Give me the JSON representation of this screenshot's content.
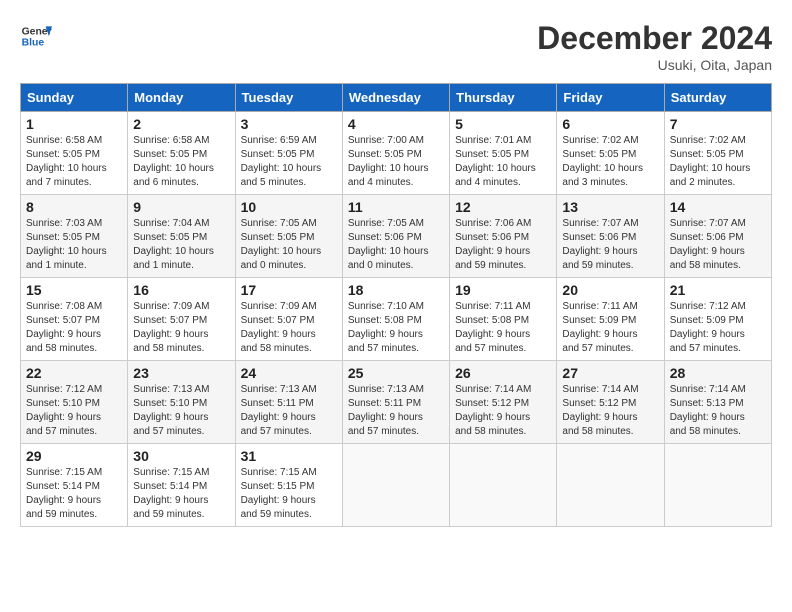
{
  "header": {
    "logo_general": "General",
    "logo_blue": "Blue",
    "month": "December 2024",
    "location": "Usuki, Oita, Japan"
  },
  "weekdays": [
    "Sunday",
    "Monday",
    "Tuesday",
    "Wednesday",
    "Thursday",
    "Friday",
    "Saturday"
  ],
  "weeks": [
    [
      {
        "day": "1",
        "info": "Sunrise: 6:58 AM\nSunset: 5:05 PM\nDaylight: 10 hours\nand 7 minutes."
      },
      {
        "day": "2",
        "info": "Sunrise: 6:58 AM\nSunset: 5:05 PM\nDaylight: 10 hours\nand 6 minutes."
      },
      {
        "day": "3",
        "info": "Sunrise: 6:59 AM\nSunset: 5:05 PM\nDaylight: 10 hours\nand 5 minutes."
      },
      {
        "day": "4",
        "info": "Sunrise: 7:00 AM\nSunset: 5:05 PM\nDaylight: 10 hours\nand 4 minutes."
      },
      {
        "day": "5",
        "info": "Sunrise: 7:01 AM\nSunset: 5:05 PM\nDaylight: 10 hours\nand 4 minutes."
      },
      {
        "day": "6",
        "info": "Sunrise: 7:02 AM\nSunset: 5:05 PM\nDaylight: 10 hours\nand 3 minutes."
      },
      {
        "day": "7",
        "info": "Sunrise: 7:02 AM\nSunset: 5:05 PM\nDaylight: 10 hours\nand 2 minutes."
      }
    ],
    [
      {
        "day": "8",
        "info": "Sunrise: 7:03 AM\nSunset: 5:05 PM\nDaylight: 10 hours\nand 1 minute."
      },
      {
        "day": "9",
        "info": "Sunrise: 7:04 AM\nSunset: 5:05 PM\nDaylight: 10 hours\nand 1 minute."
      },
      {
        "day": "10",
        "info": "Sunrise: 7:05 AM\nSunset: 5:05 PM\nDaylight: 10 hours\nand 0 minutes."
      },
      {
        "day": "11",
        "info": "Sunrise: 7:05 AM\nSunset: 5:06 PM\nDaylight: 10 hours\nand 0 minutes."
      },
      {
        "day": "12",
        "info": "Sunrise: 7:06 AM\nSunset: 5:06 PM\nDaylight: 9 hours\nand 59 minutes."
      },
      {
        "day": "13",
        "info": "Sunrise: 7:07 AM\nSunset: 5:06 PM\nDaylight: 9 hours\nand 59 minutes."
      },
      {
        "day": "14",
        "info": "Sunrise: 7:07 AM\nSunset: 5:06 PM\nDaylight: 9 hours\nand 58 minutes."
      }
    ],
    [
      {
        "day": "15",
        "info": "Sunrise: 7:08 AM\nSunset: 5:07 PM\nDaylight: 9 hours\nand 58 minutes."
      },
      {
        "day": "16",
        "info": "Sunrise: 7:09 AM\nSunset: 5:07 PM\nDaylight: 9 hours\nand 58 minutes."
      },
      {
        "day": "17",
        "info": "Sunrise: 7:09 AM\nSunset: 5:07 PM\nDaylight: 9 hours\nand 58 minutes."
      },
      {
        "day": "18",
        "info": "Sunrise: 7:10 AM\nSunset: 5:08 PM\nDaylight: 9 hours\nand 57 minutes."
      },
      {
        "day": "19",
        "info": "Sunrise: 7:11 AM\nSunset: 5:08 PM\nDaylight: 9 hours\nand 57 minutes."
      },
      {
        "day": "20",
        "info": "Sunrise: 7:11 AM\nSunset: 5:09 PM\nDaylight: 9 hours\nand 57 minutes."
      },
      {
        "day": "21",
        "info": "Sunrise: 7:12 AM\nSunset: 5:09 PM\nDaylight: 9 hours\nand 57 minutes."
      }
    ],
    [
      {
        "day": "22",
        "info": "Sunrise: 7:12 AM\nSunset: 5:10 PM\nDaylight: 9 hours\nand 57 minutes."
      },
      {
        "day": "23",
        "info": "Sunrise: 7:13 AM\nSunset: 5:10 PM\nDaylight: 9 hours\nand 57 minutes."
      },
      {
        "day": "24",
        "info": "Sunrise: 7:13 AM\nSunset: 5:11 PM\nDaylight: 9 hours\nand 57 minutes."
      },
      {
        "day": "25",
        "info": "Sunrise: 7:13 AM\nSunset: 5:11 PM\nDaylight: 9 hours\nand 57 minutes."
      },
      {
        "day": "26",
        "info": "Sunrise: 7:14 AM\nSunset: 5:12 PM\nDaylight: 9 hours\nand 58 minutes."
      },
      {
        "day": "27",
        "info": "Sunrise: 7:14 AM\nSunset: 5:12 PM\nDaylight: 9 hours\nand 58 minutes."
      },
      {
        "day": "28",
        "info": "Sunrise: 7:14 AM\nSunset: 5:13 PM\nDaylight: 9 hours\nand 58 minutes."
      }
    ],
    [
      {
        "day": "29",
        "info": "Sunrise: 7:15 AM\nSunset: 5:14 PM\nDaylight: 9 hours\nand 59 minutes."
      },
      {
        "day": "30",
        "info": "Sunrise: 7:15 AM\nSunset: 5:14 PM\nDaylight: 9 hours\nand 59 minutes."
      },
      {
        "day": "31",
        "info": "Sunrise: 7:15 AM\nSunset: 5:15 PM\nDaylight: 9 hours\nand 59 minutes."
      },
      null,
      null,
      null,
      null
    ]
  ]
}
